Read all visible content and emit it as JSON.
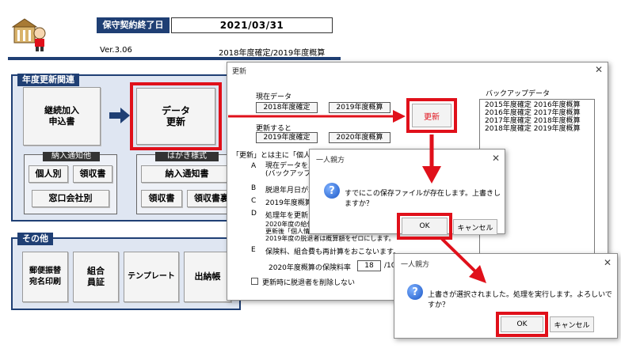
{
  "header": {
    "maintenance_label": "保守契約終了日",
    "maintenance_value": "2021/03/31",
    "version": "Ver.3.06",
    "fiscal_year": "2018年度確定/2019年度概算"
  },
  "panels": {
    "annual": {
      "title": "年度更新関連",
      "btn_enroll": "継続加入\n申込書",
      "btn_update": "データ\n更新",
      "group_notice": "納入通知他",
      "btn_individual": "個人別",
      "btn_receipt": "領収書",
      "btn_counter": "窓口会社別",
      "group_postcard": "はがき様式",
      "btn_notice_form": "納入通知書",
      "btn_receipt2": "領収書",
      "btn_receipt_back": "領収書裏"
    },
    "other": {
      "title": "その他",
      "btn_postal": "郵便振替\n宛名印刷",
      "btn_member_card": "組合\n員証",
      "btn_template": "テンプレート",
      "btn_ledger": "出納帳"
    }
  },
  "update_dialog": {
    "title": "更新",
    "close": "✕",
    "current_label": "現在データ",
    "current_confirmed": "2018年度確定",
    "current_estimate": "2019年度概算",
    "after_label": "更新すると",
    "after_confirmed": "2019年度確定",
    "after_estimate": "2020年度概算",
    "update_button": "更新",
    "backup_label": "バックアップデータ",
    "backup_items": [
      "2015年度確定 2016年度概算",
      "2016年度確定 2017年度概算",
      "2017年度確定 2018年度概算",
      "2018年度確定 2019年度概算"
    ],
    "notes_heading": "「更新」とは主に「個人情",
    "notes": [
      {
        "mark": "A",
        "text": "現在データをバ\n(バックアップのフ"
      },
      {
        "mark": "B",
        "text": "脱退年月日が2"
      },
      {
        "mark": "C",
        "text": "2019年度概算"
      },
      {
        "mark": "D",
        "text": "処理年を更新し"
      }
    ],
    "notes_extra": "2020年度の給付\n更新後「個人情\n2019年度の脱退者は概算額をゼロにします。",
    "note_e_mark": "E",
    "note_e": "保険料、組合費も再計算をおこないます。",
    "rate_label": "2020年度概算の保険料率",
    "rate_value": "18",
    "rate_suffix": "/100",
    "checkbox_label": "更新時に脱退者を削除しない"
  },
  "confirm_dialog_1": {
    "title": "一人親方",
    "close": "✕",
    "icon": "?",
    "message": "すでにこの保存ファイルが存在します。上書きしますか？",
    "ok": "OK",
    "cancel": "キャンセル"
  },
  "confirm_dialog_2": {
    "title": "一人親方",
    "close": "✕",
    "icon": "?",
    "message": "上書きが選択されました。処理を実行します。よろしいですか？",
    "ok": "OK",
    "cancel": "キャンセル"
  },
  "colors": {
    "navy": "#1f3f74",
    "highlight_red": "#e0101a",
    "panel_bg": "#dfe6f2"
  }
}
